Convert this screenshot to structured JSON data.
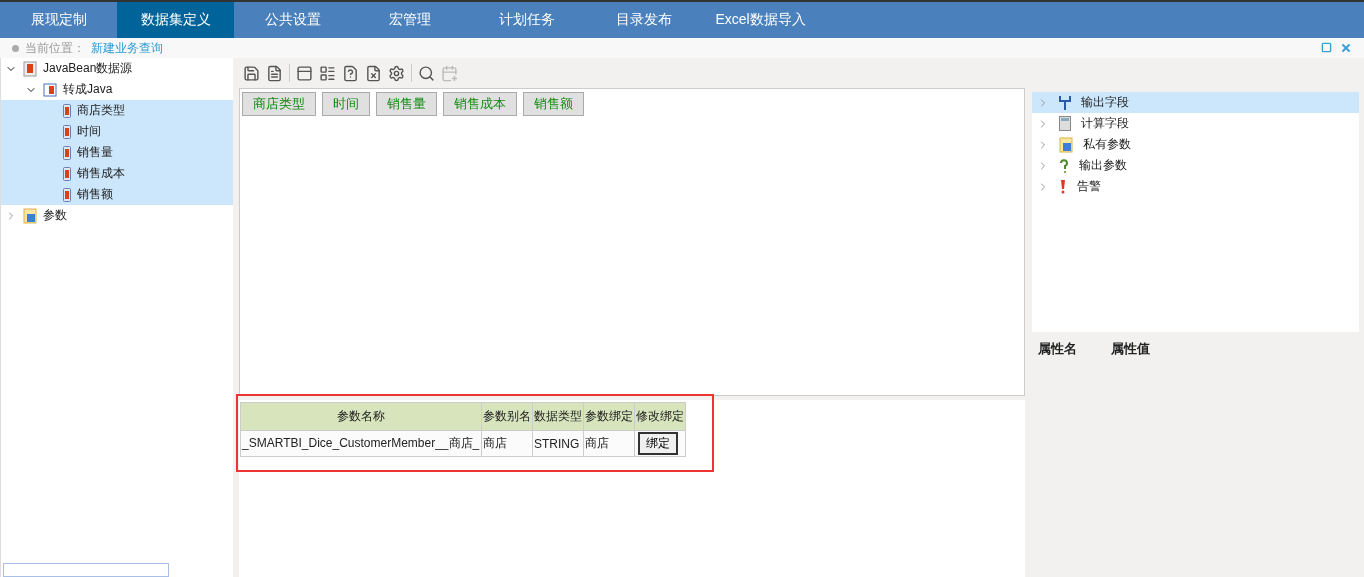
{
  "nav": {
    "tabs": [
      {
        "label": "展现定制",
        "selected": false
      },
      {
        "label": "数据集定义",
        "selected": true
      },
      {
        "label": "公共设置",
        "selected": false
      },
      {
        "label": "宏管理",
        "selected": false
      },
      {
        "label": "计划任务",
        "selected": false
      },
      {
        "label": "目录发布",
        "selected": false
      },
      {
        "label": "Excel数据导入",
        "selected": false
      }
    ]
  },
  "breadcrumb": {
    "label": "当前位置：",
    "link": "新建业务查询"
  },
  "tree": [
    {
      "label": "JavaBean数据源",
      "kind": "source",
      "expanded": true,
      "selected": false,
      "children": [
        {
          "label": "转成Java",
          "kind": "java",
          "expanded": true,
          "selected": false,
          "children": [
            {
              "label": "商店类型",
              "kind": "field",
              "selected": true
            },
            {
              "label": "时间",
              "kind": "field",
              "selected": true
            },
            {
              "label": "销售量",
              "kind": "field",
              "selected": true
            },
            {
              "label": "销售成本",
              "kind": "field",
              "selected": true
            },
            {
              "label": "销售额",
              "kind": "field",
              "selected": true
            }
          ]
        }
      ]
    },
    {
      "label": "参数",
      "kind": "params",
      "expanded": false,
      "selected": false
    }
  ],
  "fields": [
    "商店类型",
    "时间",
    "销售量",
    "销售成本",
    "销售额"
  ],
  "params_table": {
    "columns": [
      "参数名称",
      "参数别名",
      "数据类型",
      "参数绑定",
      "修改绑定"
    ],
    "rows": [
      {
        "name": "_SMARTBI_Dice_CustomerMember__商店_",
        "alias": "商店",
        "type": "STRING",
        "binding": "商店",
        "action": "绑定"
      }
    ]
  },
  "resources": [
    {
      "label": "输出字段",
      "kind": "output",
      "selected": true
    },
    {
      "label": "计算字段",
      "kind": "calc",
      "selected": false
    },
    {
      "label": "私有参数",
      "kind": "params",
      "selected": false
    },
    {
      "label": "输出参数",
      "kind": "question",
      "selected": false
    },
    {
      "label": "告警",
      "kind": "alert",
      "selected": false
    }
  ],
  "properties": {
    "columns": [
      "属性名",
      "属性值"
    ]
  }
}
